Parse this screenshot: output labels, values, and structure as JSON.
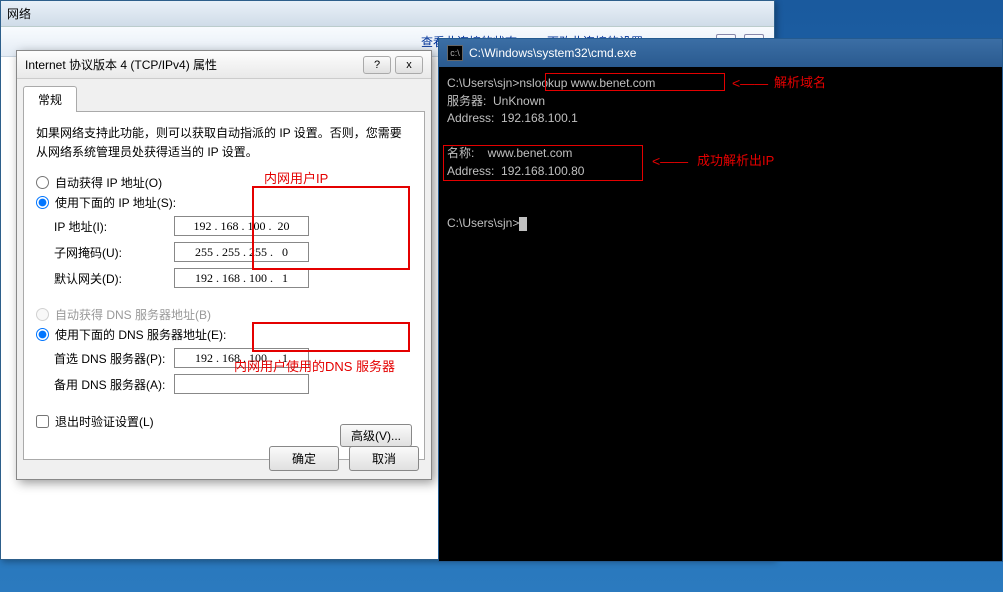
{
  "bg": {
    "title": "网络",
    "toolbar": {
      "status": "查看此连接的状态",
      "settings": "更改此连接的设置"
    }
  },
  "dlg": {
    "title": "Internet 协议版本 4 (TCP/IPv4) 属性",
    "help": "?",
    "close": "x",
    "tab": "常规",
    "desc": "如果网络支持此功能，则可以获取自动指派的 IP 设置。否则，您需要从网络系统管理员处获得适当的 IP 设置。",
    "r1": "自动获得 IP 地址(O)",
    "r2": "使用下面的 IP 地址(S):",
    "ip_label": "IP 地址(I):",
    "mask_label": "子网掩码(U):",
    "gw_label": "默认网关(D):",
    "ip": "192 . 168 . 100 .  20",
    "mask": "255 . 255 . 255 .   0",
    "gw": "192 . 168 . 100 .   1",
    "r3": "自动获得 DNS 服务器地址(B)",
    "r4": "使用下面的 DNS 服务器地址(E):",
    "dns1_label": "首选 DNS 服务器(P):",
    "dns2_label": "备用 DNS 服务器(A):",
    "dns1": "192 . 168 . 100 .   1",
    "chk": "退出时验证设置(L)",
    "adv": "高级(V)...",
    "ok": "确定",
    "cancel": "取消"
  },
  "anno": {
    "ip": "内网用户IP",
    "dns": "内网用户使用的DNS 服务器"
  },
  "cmd": {
    "title": "C:\\Windows\\system32\\cmd.exe",
    "l1_prompt": "C:\\Users\\sjn>",
    "l1_cmd": "nslookup www.benet.com",
    "l2": "服务器:  UnKnown",
    "l3": "Address:  192.168.100.1",
    "l4": "名称:    www.benet.com",
    "l5": "Address:  192.168.100.80",
    "l6_prompt": "C:\\Users\\sjn>",
    "anno1": "解析域名",
    "anno2": "成功解析出IP"
  }
}
